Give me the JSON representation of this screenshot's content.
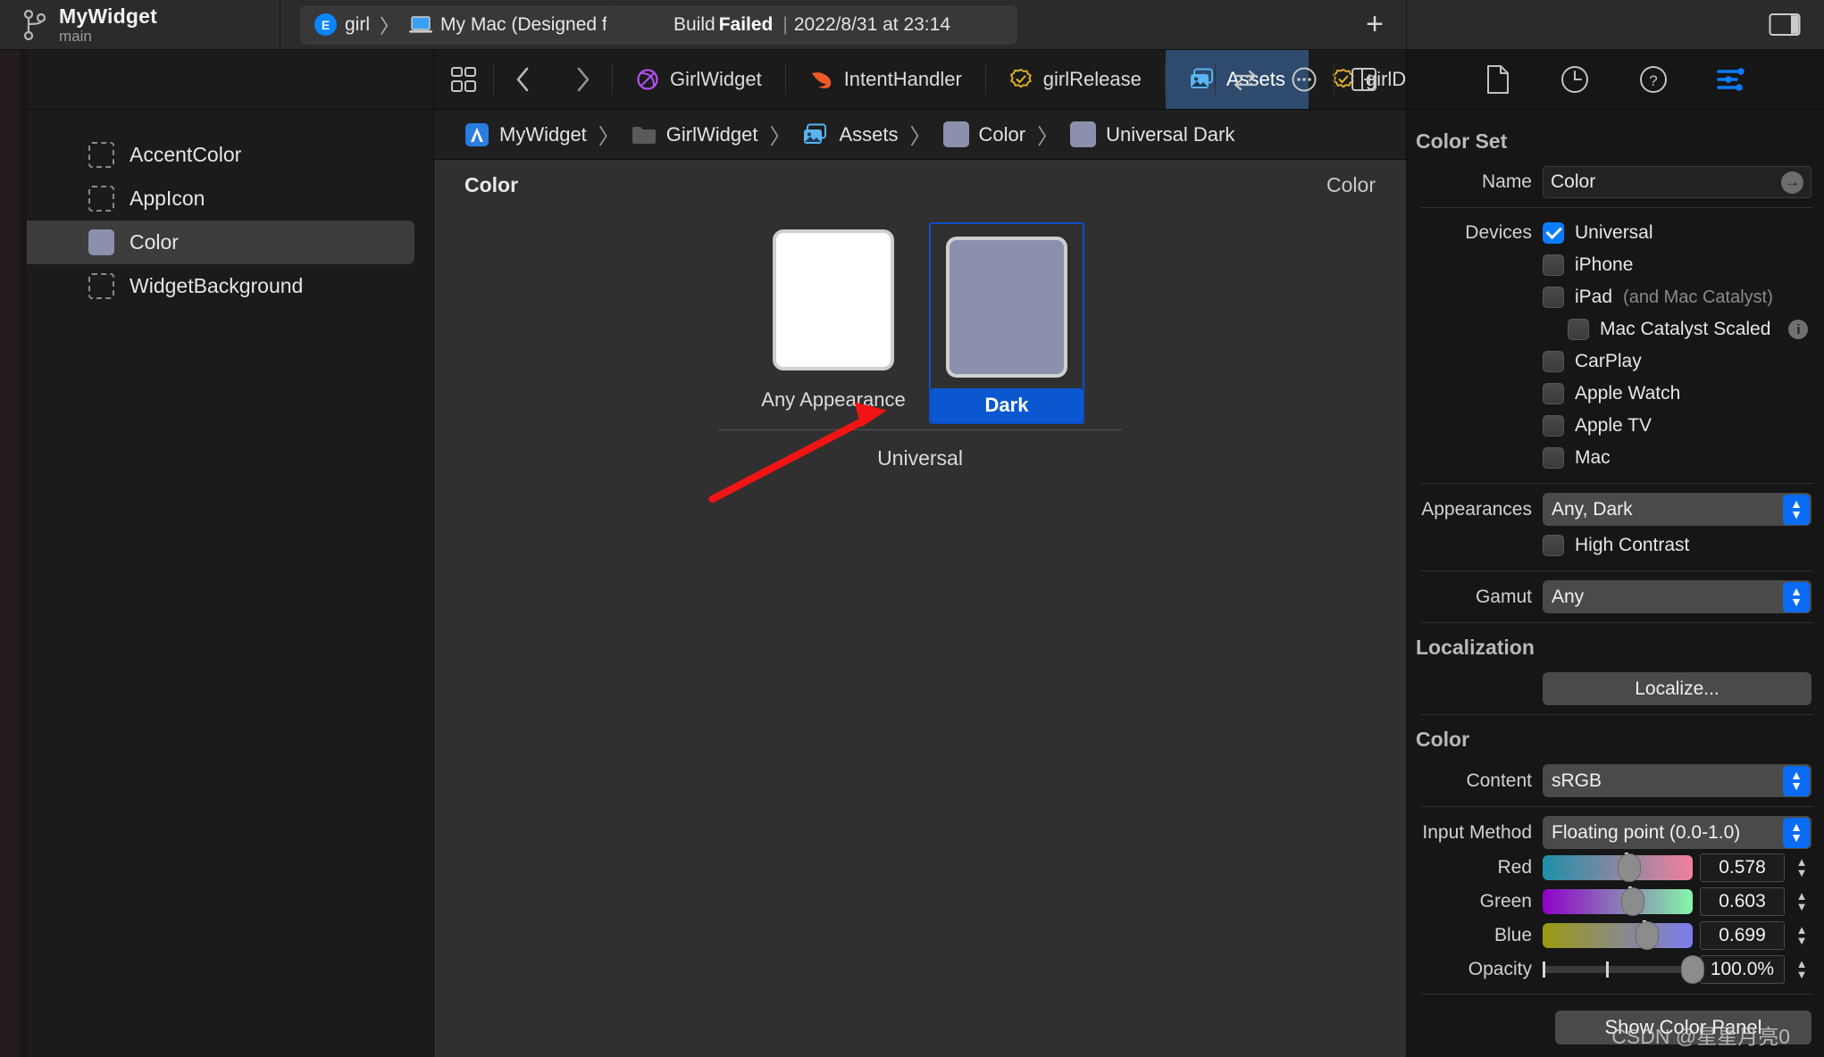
{
  "titlebar": {
    "scheme_name": "MyWidget",
    "branch": "main",
    "branch_icon": "git-branch-icon",
    "dest_badge": "E",
    "dest_scheme": "girl",
    "dest_sep": "〉",
    "dest_device": "My Mac (Designed for iPad)",
    "device_icon": "mac-laptop-icon",
    "status_prefix": "Build",
    "status_state": "Failed",
    "status_divider": "|",
    "status_time": "2022/8/31 at 23:14",
    "add_label": "+",
    "panel_toggle_icon": "right-panel-toggle-icon"
  },
  "tabbar": {
    "grid_icon": "editor-grid-icon",
    "back_icon": "chevron-left-icon",
    "forward_icon": "chevron-right-icon",
    "tabs": [
      {
        "label": "GirlWidget",
        "icon": "swiftui-widget-icon",
        "active": false
      },
      {
        "label": "IntentHandler",
        "icon": "swift-file-icon",
        "active": false
      },
      {
        "label": "girlRelease",
        "icon": "certificate-icon",
        "active": false
      },
      {
        "label": "Assets",
        "icon": "assets-catalog-icon",
        "active": true
      },
      {
        "label": "girlDebug",
        "icon": "certificate-icon",
        "active": false
      }
    ],
    "related_icon": "related-items-icon",
    "more_icon": "ellipsis-circle-icon",
    "split_icon": "add-editor-icon"
  },
  "breadcrumb": {
    "items": [
      {
        "label": "MyWidget",
        "icon": "xcode-project-icon"
      },
      {
        "label": "GirlWidget",
        "icon": "folder-icon"
      },
      {
        "label": "Assets",
        "icon": "assets-catalog-icon"
      },
      {
        "label": "Color",
        "icon": "color-swatch-icon"
      },
      {
        "label": "Universal Dark",
        "icon": "color-swatch-icon"
      }
    ],
    "separator": "〉"
  },
  "navigator": {
    "items": [
      {
        "label": "AccentColor",
        "kind": "empty"
      },
      {
        "label": "AppIcon",
        "kind": "empty"
      },
      {
        "label": "Color",
        "kind": "color",
        "selected": true
      },
      {
        "label": "WidgetBackground",
        "kind": "empty"
      }
    ]
  },
  "canvas": {
    "title": "Color",
    "right_label": "Color",
    "group_label": "Universal",
    "swatches": [
      {
        "label": "Any Appearance",
        "selected": false,
        "color": "#ffffff"
      },
      {
        "label": "Dark",
        "selected": true,
        "color": "#8b90ad"
      }
    ]
  },
  "inspector": {
    "toolbar_icons": [
      "file-inspector-icon",
      "history-inspector-icon",
      "quick-help-icon",
      "attributes-inspector-icon"
    ],
    "colorset": {
      "section_title": "Color Set",
      "name_label": "Name",
      "name_value": "Color",
      "devices_label": "Devices",
      "devices": [
        {
          "label": "Universal",
          "checked": true,
          "indent": 0
        },
        {
          "label": "iPhone",
          "checked": false,
          "indent": 0
        },
        {
          "label": "iPad",
          "sub": "(and Mac Catalyst)",
          "checked": false,
          "indent": 0
        },
        {
          "label": "Mac Catalyst Scaled",
          "checked": false,
          "indent": 1,
          "info": true
        },
        {
          "label": "CarPlay",
          "checked": false,
          "indent": 0
        },
        {
          "label": "Apple Watch",
          "checked": false,
          "indent": 0
        },
        {
          "label": "Apple TV",
          "checked": false,
          "indent": 0
        },
        {
          "label": "Mac",
          "checked": false,
          "indent": 0
        }
      ],
      "appearances_label": "Appearances",
      "appearances_value": "Any, Dark",
      "high_contrast_label": "High Contrast",
      "high_contrast_checked": false,
      "gamut_label": "Gamut",
      "gamut_value": "Any"
    },
    "localization": {
      "section_title": "Localization",
      "button_label": "Localize..."
    },
    "color": {
      "section_title": "Color",
      "content_label": "Content",
      "content_value": "sRGB",
      "input_method_label": "Input Method",
      "input_method_value": "Floating point (0.0-1.0)",
      "channels": [
        {
          "label": "Red",
          "value": "0.578",
          "fraction": 0.578,
          "gradient_from": "#1e8fa8",
          "gradient_to": "#f2809d"
        },
        {
          "label": "Green",
          "value": "0.603",
          "fraction": 0.603,
          "gradient_from": "#9000c8",
          "gradient_to": "#84f7a8"
        },
        {
          "label": "Blue",
          "value": "0.699",
          "fraction": 0.699,
          "gradient_from": "#9a9a10",
          "gradient_to": "#7b7bf0"
        }
      ],
      "opacity_label": "Opacity",
      "opacity_value": "100.0%",
      "opacity_fraction": 1.0,
      "show_panel_label": "Show Color Panel"
    }
  },
  "watermark": "CSDN @星星月亮0",
  "colors": {
    "accent_blue": "#0a7cff",
    "selected_tab": "#2e4a6d",
    "swatch_dark": "#8b90ad",
    "annotation_arrow": "#f21414"
  }
}
